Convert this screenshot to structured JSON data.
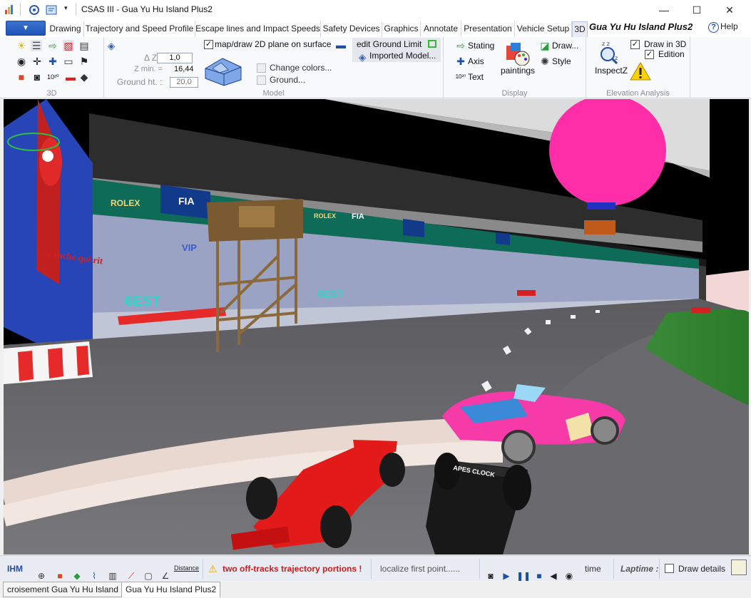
{
  "window": {
    "title": "CSAS III - Gua Yu Hu Island Plus2",
    "minimize": "—",
    "maximize": "☐",
    "close": "✕"
  },
  "ribbon": {
    "tabs": [
      "Drawing",
      "Trajectory and Speed Profile",
      "Escape lines and Impact Speeds",
      "Safety Devices",
      "Graphics",
      "Annotate",
      "Presentation",
      "Vehicle Setup",
      "3D"
    ],
    "active_tab": "3D",
    "title": "Gua Yu Hu Island Plus2",
    "help_label": "Help",
    "groups": {
      "g3d": {
        "label": "3D"
      },
      "model": {
        "label": "Model",
        "dz_label": "Δ Z x",
        "dz_value": "1,0",
        "zmin_label": "Z min. =",
        "zmin_value": "16,44",
        "ground_label": "Ground ht. :",
        "ground_value": "20,0",
        "map_plane_label": "map/draw 2D plane on surface",
        "change_colors_label": "Change colors...",
        "ground_btn_label": "Ground...",
        "edit_ground_label": "edit Ground Limit",
        "imported_model_label": "Imported Model..."
      },
      "display": {
        "label": "Display",
        "stating_label": "Stating",
        "axis_label": "Axis",
        "text_label": "Text",
        "paintings_label": "paintings",
        "draw_label": "Draw...",
        "style_label": "Style"
      },
      "elevation": {
        "label": "Elevation Analysis",
        "inspect_label": "InspectZ",
        "draw3d_label": "Draw in 3D",
        "edition_label": "Edition"
      }
    }
  },
  "viewport": {
    "banners": {
      "rolex": "ROLEX",
      "fia": "FIA",
      "vip": "VIP",
      "best": "6EST",
      "vache": "la vache qui rit"
    },
    "car_livery": "APES CLOCK"
  },
  "statusbar": {
    "ihm": "IHM",
    "warning": "two off-tracks trajectory portions !",
    "localize": "localize first point......",
    "time_label": "time",
    "laptime_label": "Laptime :",
    "draw_details_label": "Draw details",
    "distance_label": "Distance"
  },
  "doc_tabs": [
    "croisement Gua Yu Hu Island",
    "Gua Yu Hu Island Plus2"
  ],
  "active_doc_tab": "Gua Yu Hu Island Plus2"
}
